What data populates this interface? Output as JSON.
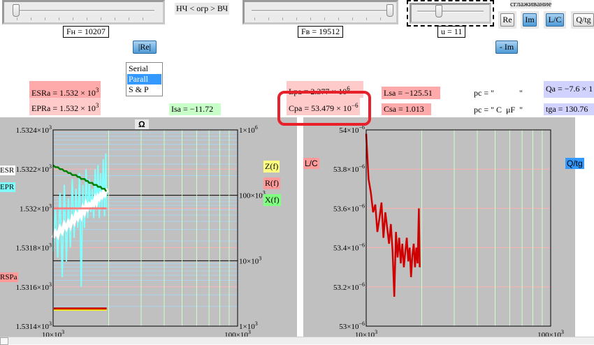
{
  "controls": {
    "fn_slider": {
      "value_fraction": 0.02
    },
    "fn_label": "Fн = 10207",
    "range_label": "НЧ < огр > ВЧ",
    "fv_slider": {
      "value_fraction": 0.97
    },
    "fv_label": "Fв = 19512",
    "u_slider": {
      "value_fraction": 0.3
    },
    "u_label": "u = 11",
    "smoothing_label": "сглаживание",
    "toggles": [
      {
        "label": "Re",
        "active": false
      },
      {
        "label": "Im",
        "active": true
      },
      {
        "label": "L/C",
        "active": true
      },
      {
        "label": "Q/tg",
        "active": false
      }
    ],
    "re_button": "|Re|",
    "minus_im_button": "- Im",
    "mode_list": {
      "options": [
        "Serial",
        "Parall",
        "S & P"
      ],
      "selected": "Parall"
    }
  },
  "results": {
    "esra": {
      "text": "ESRa = 1.532 × 10",
      "exp": "3"
    },
    "epra": {
      "text": "EPRa = 1.532 × 10",
      "exp": "3"
    },
    "isa": "Isa = −11.72",
    "lpa": {
      "text": "Lpa = 2.377 × 10",
      "exp": "6"
    },
    "cpa": {
      "text": "Cpa = 53.479 × 10",
      "exp": "−6"
    },
    "lsa": "Lsa = −125.51",
    "csa": "Csa = 1.013",
    "pc1": "pc = \"            \"",
    "pc2": "pc = \" C  μF  \"",
    "qa": "Qa = −7.6 × 1",
    "tga": "tga = 130.76"
  },
  "highlight_color": "#e8202a",
  "chart_data": [
    {
      "type": "line",
      "title": "Ω",
      "x_scale": "log",
      "xlim": [
        10000,
        100000
      ],
      "x_tick_labels": [
        {
          "m": "10×10",
          "e": "3"
        },
        {
          "m": "100×10",
          "e": "3"
        }
      ],
      "ylim": [
        1531.4,
        1532.4
      ],
      "y_tick_labels": [
        {
          "m": "1.5324×10",
          "e": "3",
          "v": 1532.4
        },
        {
          "m": "1.5322×10",
          "e": "3",
          "v": 1532.2
        },
        {
          "m": "1.532×10",
          "e": "3",
          "v": 1532.0
        },
        {
          "m": "1.5318×10",
          "e": "3",
          "v": 1531.8
        },
        {
          "m": "1.5316×10",
          "e": "3",
          "v": 1531.6
        },
        {
          "m": "1.5314×10",
          "e": "3",
          "v": 1531.4
        }
      ],
      "y2_scale": "log",
      "y2lim": [
        1000,
        1000000
      ],
      "y2_tick_labels": [
        {
          "m": "1×10",
          "e": "6",
          "v": 1000000
        },
        {
          "m": "100×10",
          "e": "3",
          "v": 100000
        },
        {
          "m": "10×10",
          "e": "3",
          "v": 10000
        },
        {
          "m": "1×10",
          "e": "3",
          "v": 1000
        }
      ],
      "side_labels": {
        "esr": "ESR",
        "epr": "EPR",
        "rspa": "RSPa",
        "z": "Z(f)",
        "r": "R(f)",
        "x": "X(f)"
      },
      "x": [
        10000,
        10300,
        10600,
        10900,
        11200,
        11500,
        11800,
        12100,
        12400,
        12700,
        13000,
        13300,
        13600,
        13900,
        14200,
        14500,
        14800,
        15100,
        15400,
        15700,
        16000,
        16300,
        16600,
        16900,
        17200,
        17500,
        17800,
        18100,
        18400,
        18700,
        19000,
        19300,
        19512
      ],
      "series": [
        {
          "name": "EPR",
          "color": "#80ffff",
          "values": [
            1531.78,
            1532.0,
            1531.75,
            1532.08,
            1531.65,
            1532.12,
            1531.73,
            1532.05,
            1531.8,
            1532.15,
            1531.85,
            1532.1,
            1531.9,
            1532.18,
            1531.6,
            1532.12,
            1531.9,
            1532.2,
            1531.95,
            1532.15,
            1531.98,
            1532.1,
            1531.95,
            1532.2,
            1532.0,
            1532.22,
            1531.95,
            1532.18,
            1532.0,
            1532.25,
            1531.96,
            1532.28,
            1532.0
          ]
        },
        {
          "name": "ESR",
          "color": "#ffffff",
          "values": [
            1531.85,
            1531.88,
            1531.86,
            1531.9,
            1531.88,
            1531.92,
            1531.9,
            1531.93,
            1531.91,
            1531.95,
            1531.93,
            1531.97,
            1531.95,
            1531.98,
            1531.96,
            1532.0,
            1531.98,
            1532.02,
            1532.0,
            1532.02,
            1532.01,
            1532.03,
            1532.02,
            1532.05,
            1532.03,
            1532.06,
            1532.05,
            1532.07,
            1532.06,
            1532.08,
            1532.07,
            1532.1,
            1532.08
          ]
        },
        {
          "name": "X(f)",
          "color": "#008000",
          "values": [
            1532.22,
            1532.21,
            1532.21,
            1532.2,
            1532.2,
            1532.19,
            1532.19,
            1532.18,
            1532.18,
            1532.17,
            1532.17,
            1532.17,
            1532.16,
            1532.16,
            1532.15,
            1532.15,
            1532.15,
            1532.14,
            1532.14,
            1532.13,
            1532.13,
            1532.13,
            1532.12,
            1532.12,
            1532.12,
            1532.11,
            1532.11,
            1532.11,
            1532.1,
            1532.1,
            1532.1,
            1532.09,
            1532.09
          ]
        },
        {
          "name": "R(f)",
          "color": "#ff8080",
          "constant": 1532.0
        },
        {
          "name": "Z(f)",
          "color": "#cc0000",
          "constant": 1531.49
        }
      ]
    },
    {
      "type": "line",
      "title": "",
      "x_scale": "log",
      "xlim": [
        10000,
        100000
      ],
      "x_tick_labels": [
        {
          "m": "10×10",
          "e": "3"
        },
        {
          "m": "100×10",
          "e": "3"
        }
      ],
      "ylim": [
        53.0,
        54.0
      ],
      "y_tick_labels": [
        {
          "m": "54×10",
          "e": "−6",
          "v": 54.0
        },
        {
          "m": "53.8×10",
          "e": "−6",
          "v": 53.8
        },
        {
          "m": "53.6×10",
          "e": "−6",
          "v": 53.6
        },
        {
          "m": "53.4×10",
          "e": "−6",
          "v": 53.4
        },
        {
          "m": "53.2×10",
          "e": "−6",
          "v": 53.2
        },
        {
          "m": "53×10",
          "e": "−6",
          "v": 53.0
        }
      ],
      "side_labels": {
        "lc": "L/C",
        "qtg": "Q/tg"
      },
      "x": [
        10000,
        10300,
        10600,
        10900,
        11200,
        11500,
        11800,
        12100,
        12400,
        12700,
        13000,
        13300,
        13600,
        13900,
        14200,
        14500,
        14800,
        15100,
        15400,
        15700,
        16000,
        16300,
        16600,
        16900,
        17200,
        17500,
        17800,
        18100,
        18400,
        18700,
        19000,
        19300,
        19512
      ],
      "series": [
        {
          "name": "Cp",
          "color": "#d00000",
          "values": [
            53.98,
            53.75,
            53.68,
            53.58,
            53.62,
            53.48,
            53.55,
            53.63,
            53.45,
            53.58,
            53.5,
            53.42,
            53.52,
            53.38,
            53.15,
            53.48,
            53.35,
            53.45,
            53.32,
            53.42,
            53.3,
            53.38,
            53.45,
            53.33,
            53.4,
            53.25,
            53.36,
            53.42,
            53.3,
            53.4,
            53.32,
            53.6,
            53.3
          ]
        }
      ]
    }
  ]
}
